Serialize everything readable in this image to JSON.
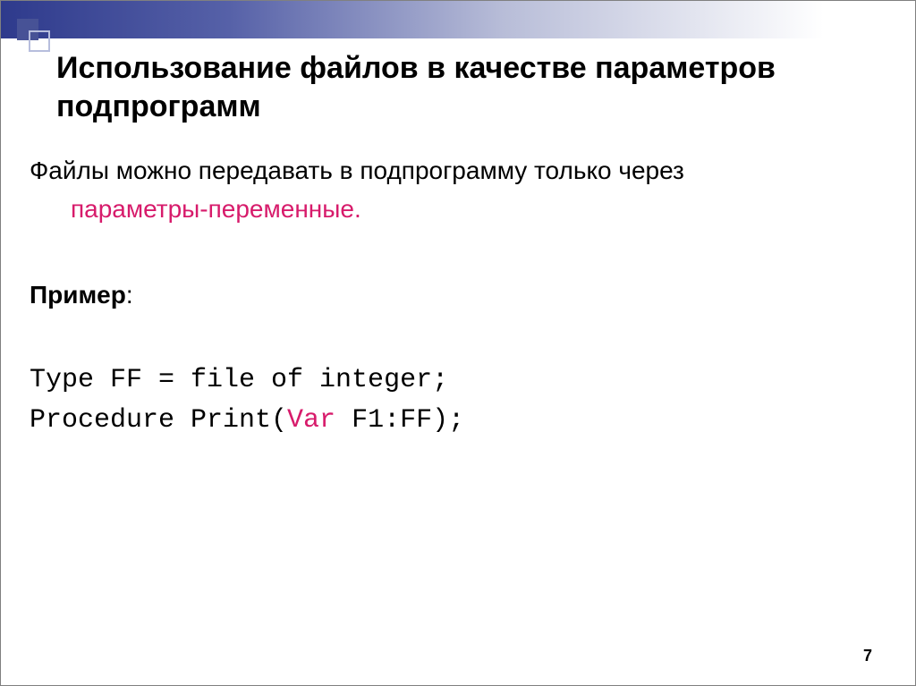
{
  "title": "Использование файлов в качестве параметров подпрограмм",
  "intro": {
    "part1": "Файлы можно передавать в подпрограмму только через ",
    "highlight": "параметры-переменные."
  },
  "example_label": "Пример",
  "example_colon": ":",
  "code": {
    "line1": "Type FF = file of integer;",
    "line2a": "Procedure Print(",
    "line2b": "Var",
    "line2c": " F1:FF);"
  },
  "page_number": "7"
}
